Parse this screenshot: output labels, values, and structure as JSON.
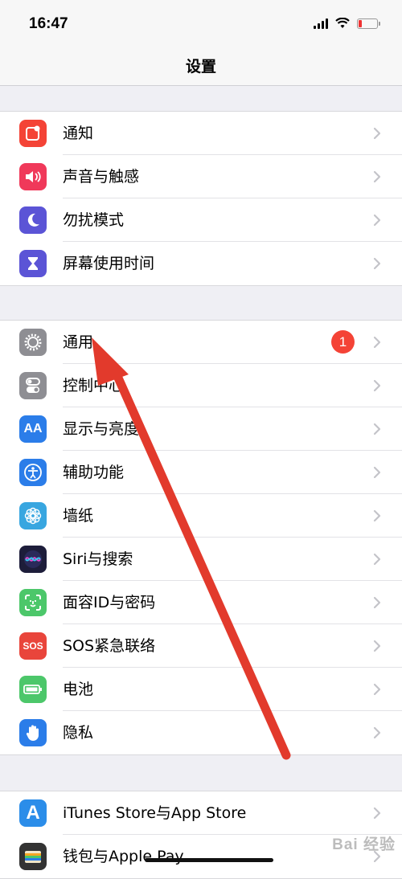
{
  "status": {
    "time": "16:47"
  },
  "nav": {
    "title": "设置"
  },
  "group1": [
    {
      "label": "通知",
      "icon": "notifications-icon",
      "color": "#f44336"
    },
    {
      "label": "声音与触感",
      "icon": "speaker-icon",
      "color": "#f0395a"
    },
    {
      "label": "勿扰模式",
      "icon": "moon-icon",
      "color": "#5b54d6"
    },
    {
      "label": "屏幕使用时间",
      "icon": "hourglass-icon",
      "color": "#5b54d6"
    }
  ],
  "group2": [
    {
      "label": "通用",
      "icon": "gear-icon",
      "color": "#8e8e93",
      "badge": "1"
    },
    {
      "label": "控制中心",
      "icon": "toggle-icon",
      "color": "#8e8e93"
    },
    {
      "label": "显示与亮度",
      "icon": "text-size-icon",
      "color": "#2b7de9",
      "glyph": "AA"
    },
    {
      "label": "辅助功能",
      "icon": "accessibility-icon",
      "color": "#2b7de9"
    },
    {
      "label": "墙纸",
      "icon": "flower-icon",
      "color": "#38a6e0"
    },
    {
      "label": "Siri与搜索",
      "icon": "siri-icon",
      "color": "#1d1d3a"
    },
    {
      "label": "面容ID与密码",
      "icon": "face-id-icon",
      "color": "#4cc76a"
    },
    {
      "label": "SOS紧急联络",
      "icon": "sos-icon",
      "color": "#e9453b",
      "glyph": "SOS"
    },
    {
      "label": "电池",
      "icon": "battery-icon",
      "color": "#4cc76a"
    },
    {
      "label": "隐私",
      "icon": "hand-icon",
      "color": "#2b7de9"
    }
  ],
  "group3": [
    {
      "label": "iTunes Store与App Store",
      "icon": "app-store-icon",
      "color": "#2b8de9",
      "glyph": "A"
    },
    {
      "label": "钱包与Apple Pay",
      "icon": "wallet-icon",
      "color": "#333333"
    }
  ],
  "watermark": "Bai 经验"
}
